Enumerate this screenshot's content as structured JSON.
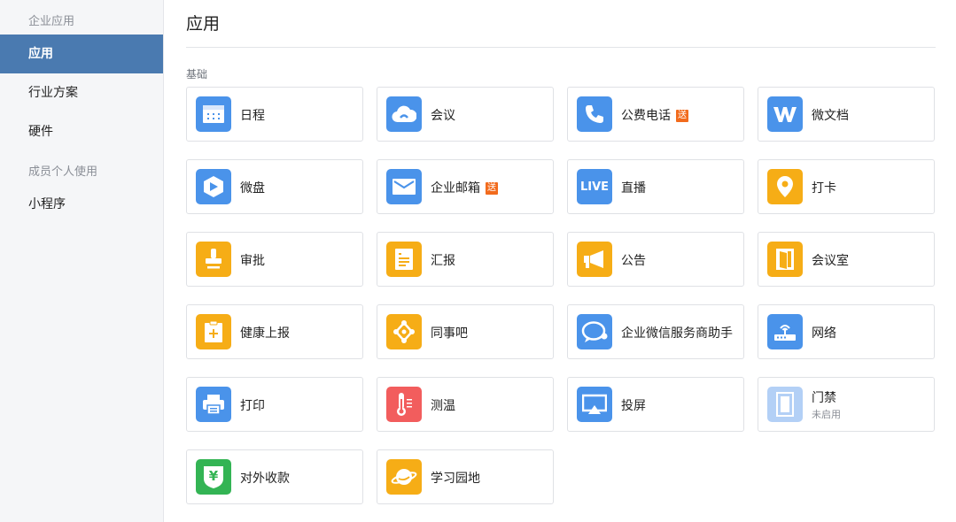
{
  "sidebar": {
    "group_enterprise": "企业应用",
    "group_member": "成员个人使用",
    "items": [
      {
        "label": "应用"
      },
      {
        "label": "行业方案"
      },
      {
        "label": "硬件"
      },
      {
        "label": "小程序"
      }
    ]
  },
  "main": {
    "title": "应用",
    "section": "基础",
    "apps": [
      {
        "label": "日程",
        "icon": "calendar-icon",
        "color": "#4a93ea"
      },
      {
        "label": "会议",
        "icon": "cloud-meeting-icon",
        "color": "#4a93ea"
      },
      {
        "label": "公费电话",
        "icon": "phone-icon",
        "color": "#4a93ea",
        "badge": "送"
      },
      {
        "label": "微文档",
        "icon": "w-doc-icon",
        "color": "#4a93ea"
      },
      {
        "label": "微盘",
        "icon": "drive-icon",
        "color": "#4a93ea"
      },
      {
        "label": "企业邮箱",
        "icon": "mail-icon",
        "color": "#4a93ea",
        "badge": "送"
      },
      {
        "label": "直播",
        "icon": "live-icon",
        "color": "#4a93ea",
        "icon_text": "LIVE"
      },
      {
        "label": "打卡",
        "icon": "location-pin-icon",
        "color": "#f6ad16"
      },
      {
        "label": "审批",
        "icon": "stamp-icon",
        "color": "#f6ad16"
      },
      {
        "label": "汇报",
        "icon": "report-icon",
        "color": "#f6ad16"
      },
      {
        "label": "公告",
        "icon": "megaphone-icon",
        "color": "#f6ad16"
      },
      {
        "label": "会议室",
        "icon": "door-room-icon",
        "color": "#f6ad16"
      },
      {
        "label": "健康上报",
        "icon": "health-clipboard-icon",
        "color": "#f6ad16"
      },
      {
        "label": "同事吧",
        "icon": "network-nodes-icon",
        "color": "#f6ad16"
      },
      {
        "label": "企业微信服务商助手",
        "icon": "chat-bubble-icon",
        "color": "#4a93ea"
      },
      {
        "label": "网络",
        "icon": "router-icon",
        "color": "#4a93ea"
      },
      {
        "label": "打印",
        "icon": "printer-icon",
        "color": "#4a93ea"
      },
      {
        "label": "测温",
        "icon": "thermometer-icon",
        "color": "#f25d5d"
      },
      {
        "label": "投屏",
        "icon": "screen-cast-icon",
        "color": "#4a93ea"
      },
      {
        "label": "门禁",
        "icon": "door-access-icon",
        "color": "#b3d0f6",
        "sub": "未启用"
      },
      {
        "label": "对外收款",
        "icon": "yuan-shield-icon",
        "color": "#33b454",
        "icon_text": "¥"
      },
      {
        "label": "学习园地",
        "icon": "planet-icon",
        "color": "#f6ad16"
      }
    ]
  }
}
